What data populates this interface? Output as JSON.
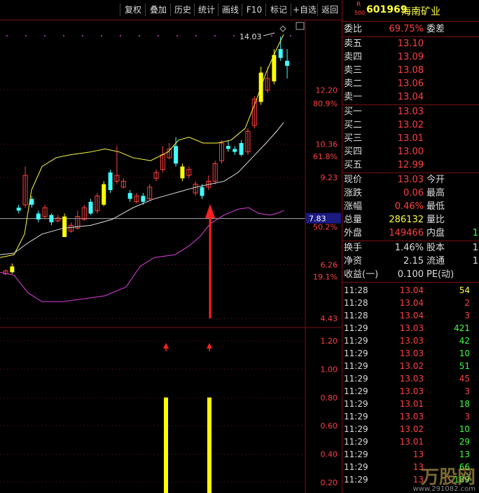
{
  "toolbar": {
    "items": [
      "复权",
      "叠加",
      "历史",
      "统计",
      "画线",
      "F10",
      "标记",
      "+自选",
      "返回"
    ]
  },
  "chart": {
    "price_ticks": [
      "14.03",
      "12.20",
      "10.36",
      "9.23",
      "7.83",
      "6.26",
      "4.43"
    ],
    "pct_ticks": [
      "80.9%",
      "61.8%",
      "50.2%",
      "19.1%"
    ],
    "current_marker": "7.83",
    "lower_ticks": [
      "1.20",
      "1.00",
      "0.80",
      "0.60",
      "0.40",
      "0.20"
    ],
    "high_label": "14.03"
  },
  "panel": {
    "badge": "R",
    "badge_sub": "500",
    "code": "601969",
    "name": "海南矿业",
    "weibi_label": "委比",
    "weibi_value": "69.75%",
    "weicha_label": "委差",
    "asks": [
      {
        "label": "卖五",
        "price": "13.10"
      },
      {
        "label": "卖四",
        "price": "13.09"
      },
      {
        "label": "卖三",
        "price": "13.08"
      },
      {
        "label": "卖二",
        "price": "13.06"
      },
      {
        "label": "卖一",
        "price": "13.04"
      }
    ],
    "bids": [
      {
        "label": "买一",
        "price": "13.03"
      },
      {
        "label": "买二",
        "price": "13.02"
      },
      {
        "label": "买三",
        "price": "13.01"
      },
      {
        "label": "买四",
        "price": "13.00"
      },
      {
        "label": "买五",
        "price": "12.99"
      }
    ],
    "stats": [
      {
        "l1": "现价",
        "v1": "13.03",
        "l2": "今开"
      },
      {
        "l1": "涨跌",
        "v1": "0.06",
        "l2": "最高"
      },
      {
        "l1": "涨幅",
        "v1": "0.46%",
        "l2": "最低"
      },
      {
        "l1": "总量",
        "v1": "286132",
        "l2": "量比"
      },
      {
        "l1": "外盘",
        "v1": "149466",
        "l2": "内盘",
        "v2": "1"
      }
    ],
    "stats2": [
      {
        "l1": "换手",
        "v1": "1.46%",
        "l2": "股本",
        "v2": "1"
      },
      {
        "l1": "净资",
        "v1": "2.15",
        "l2": "流通",
        "v2": "1"
      },
      {
        "l1": "收益(一)",
        "v1": "0.100",
        "l2": "PE(动)"
      }
    ],
    "trades": [
      {
        "t": "11:28",
        "p": "13.04",
        "v": "54",
        "c": "yel"
      },
      {
        "t": "11:28",
        "p": "13.04",
        "v": "2",
        "c": "red"
      },
      {
        "t": "11:28",
        "p": "13.04",
        "v": "3",
        "c": "red"
      },
      {
        "t": "11:29",
        "p": "13.03",
        "v": "421",
        "c": "grn"
      },
      {
        "t": "11:29",
        "p": "13.03",
        "v": "42",
        "c": "grn"
      },
      {
        "t": "11:29",
        "p": "13.03",
        "v": "10",
        "c": "grn"
      },
      {
        "t": "11:29",
        "p": "13.02",
        "v": "51",
        "c": "grn"
      },
      {
        "t": "11:29",
        "p": "13.03",
        "v": "45",
        "c": "red"
      },
      {
        "t": "11:29",
        "p": "13.03",
        "v": "3",
        "c": "red"
      },
      {
        "t": "11:29",
        "p": "13.01",
        "v": "18",
        "c": "grn"
      },
      {
        "t": "11:29",
        "p": "13.03",
        "v": "3",
        "c": "red"
      },
      {
        "t": "11:29",
        "p": "13.02",
        "v": "10",
        "c": "grn"
      },
      {
        "t": "11:29",
        "p": "13.01",
        "v": "29",
        "c": "grn"
      },
      {
        "t": "11:29",
        "p": "13",
        "v": "13",
        "c": "grn"
      },
      {
        "t": "11:29",
        "p": "13",
        "v": "66",
        "c": "grn"
      },
      {
        "t": "11:29",
        "p": "13",
        "v": "189",
        "c": "grn"
      }
    ],
    "watermark": "万股网",
    "watermark_url": "www.291082.com"
  },
  "colors": {
    "up": "#ff4040",
    "down": "#40ffff",
    "yellow": "#ffff00",
    "magenta": "#e040e0",
    "border": "#7a1010"
  }
}
